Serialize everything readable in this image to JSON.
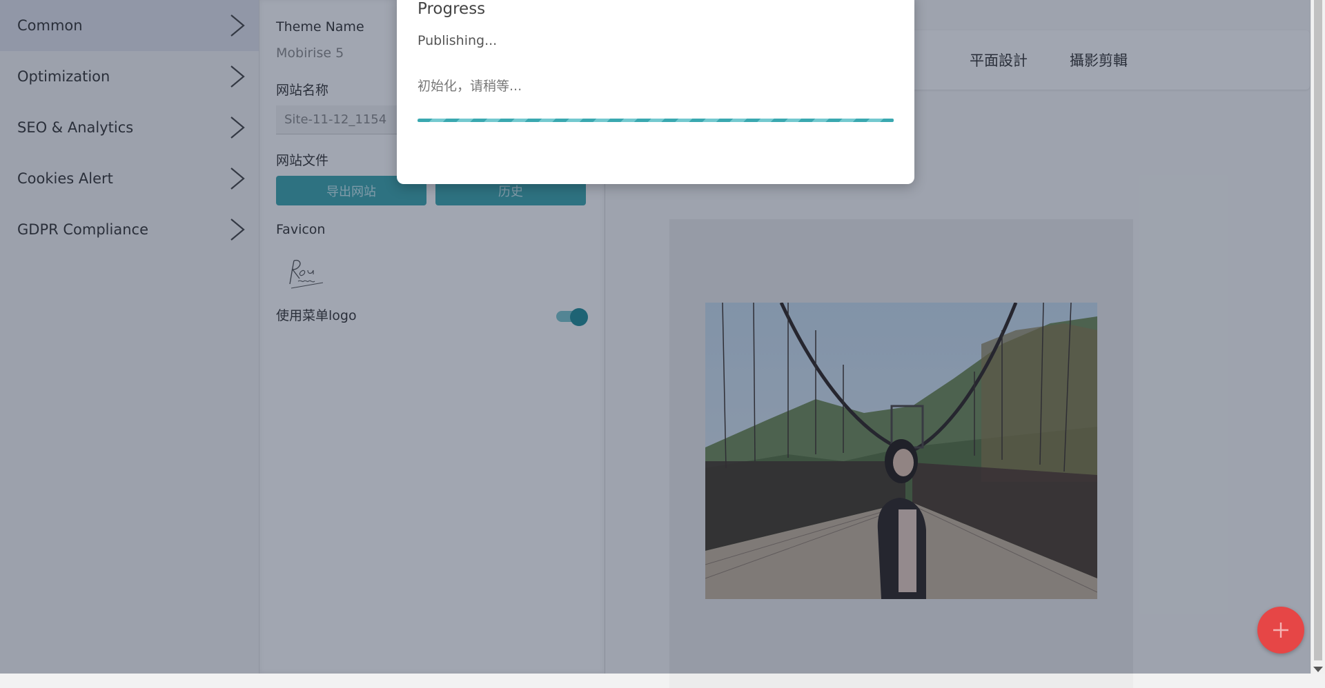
{
  "sidebar": {
    "items": [
      {
        "label": "Common"
      },
      {
        "label": "Optimization"
      },
      {
        "label": "SEO & Analytics"
      },
      {
        "label": "Cookies Alert"
      },
      {
        "label": "GDPR Compliance"
      }
    ]
  },
  "panel": {
    "theme_name_label": "Theme Name",
    "theme_name_value": "Mobirise 5",
    "site_name_label": "网站名称",
    "site_name_value": "Site-11-12_1154",
    "site_files_label": "网站文件",
    "export_button": "导出网站",
    "history_button": "历史",
    "favicon_label": "Favicon",
    "favicon_text": "Rou mogu",
    "menu_logo_label": "使用菜单logo",
    "menu_logo_enabled": true
  },
  "preview": {
    "nav_links": [
      "平面設計",
      "攝影剪輯"
    ]
  },
  "modal": {
    "title": "Progress",
    "status": "Publishing...",
    "detail": "初始化，请稍等...",
    "progress_color": "#3aa8b0"
  },
  "colors": {
    "accent": "#3aa5ad",
    "fab": "#e64646"
  }
}
